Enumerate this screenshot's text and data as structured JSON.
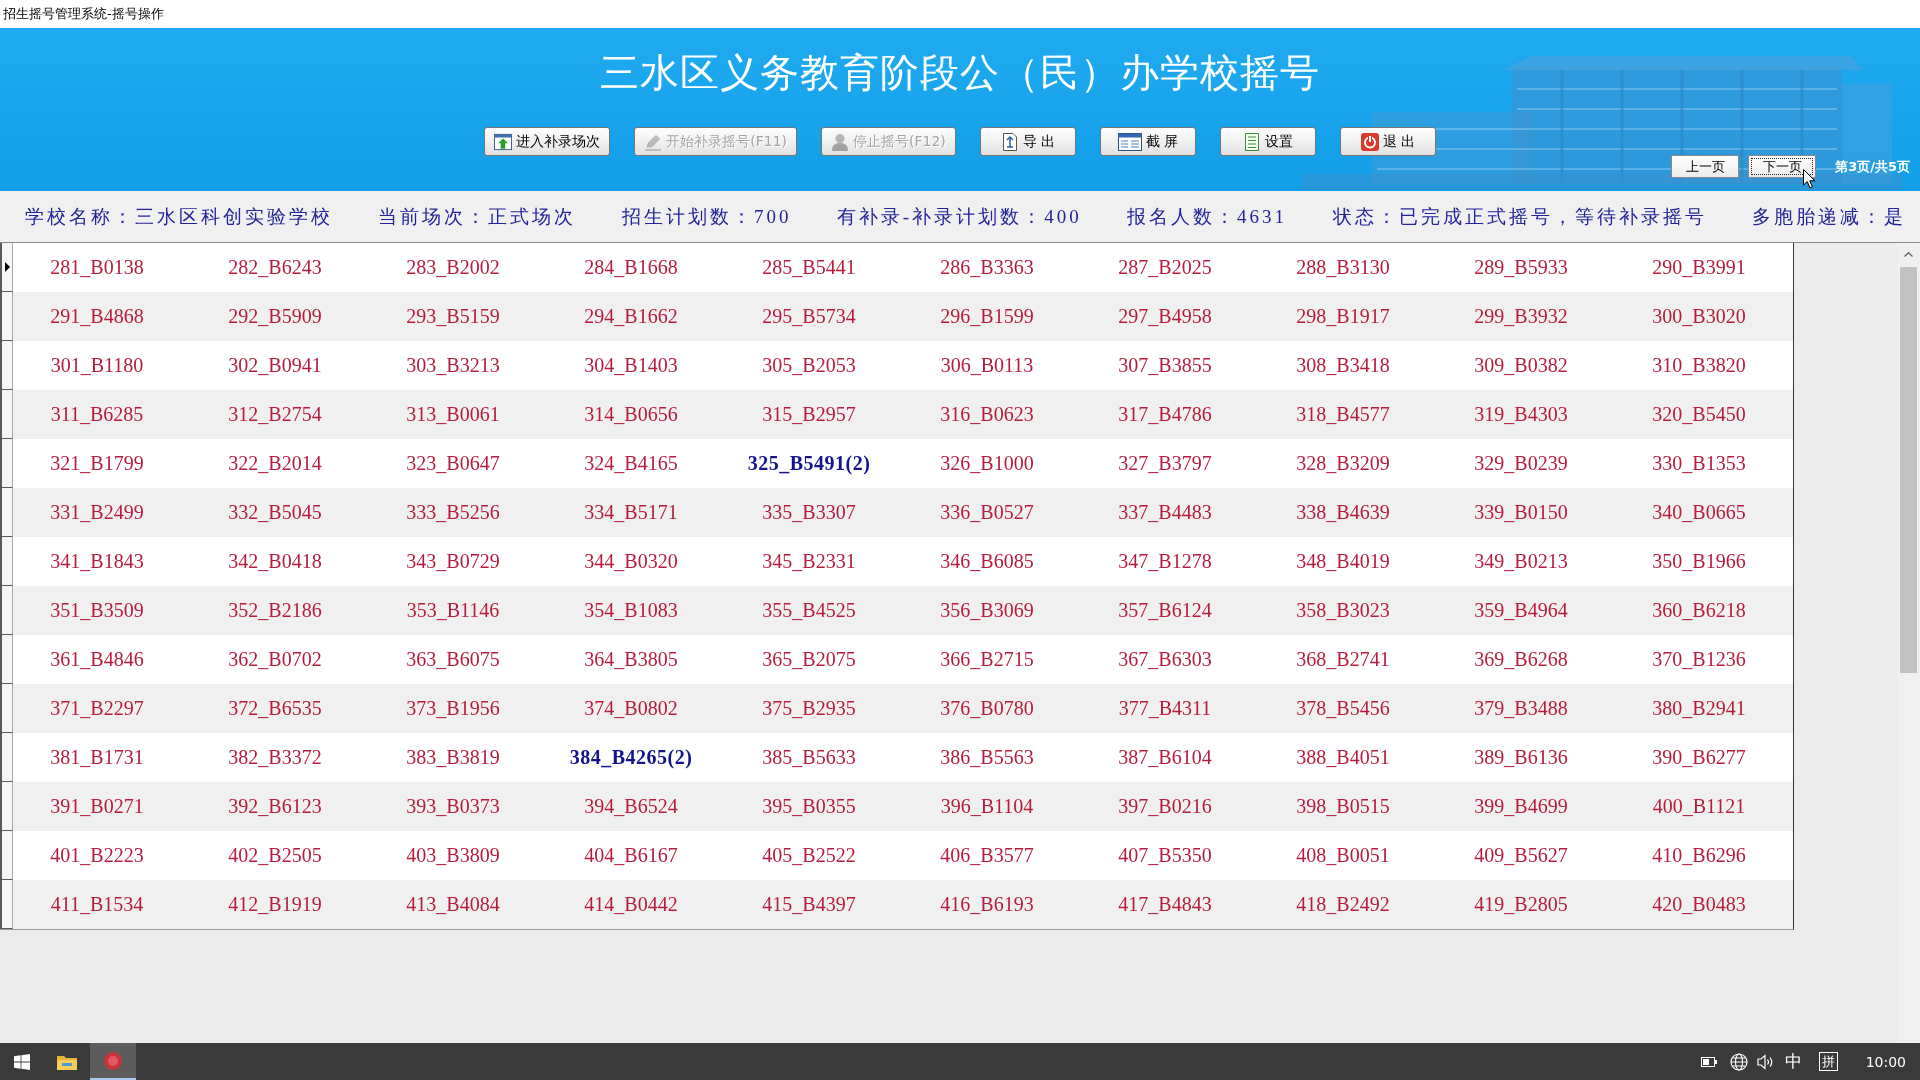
{
  "window": {
    "title": "招生摇号管理系统-摇号操作"
  },
  "header": {
    "title": "三水区义务教育阶段公（民）办学校摇号"
  },
  "toolbar": {
    "buttons": [
      {
        "label": "进入补录场次",
        "disabled": false
      },
      {
        "label": "开始补录摇号(F11)",
        "disabled": true
      },
      {
        "label": "停止摇号(F12)",
        "disabled": true
      },
      {
        "label": "导 出",
        "disabled": false
      },
      {
        "label": "截 屏",
        "disabled": false
      },
      {
        "label": "设置",
        "disabled": false
      },
      {
        "label": "退 出",
        "disabled": false
      }
    ]
  },
  "pager": {
    "buttons": [
      {
        "label": "上一页",
        "focused": false
      },
      {
        "label": "下一页",
        "focused": true
      }
    ],
    "page_info": "第3页/共5页"
  },
  "info_bar": {
    "items": [
      "学校名称：三水区科创实验学校",
      "当前场次：正式场次",
      "招生计划数：700",
      "有补录-补录计划数：400",
      "报名人数：4631",
      "状态：已完成正式摇号，等待补录摇号",
      "多胞胎递减：是"
    ]
  },
  "grid": {
    "rows": [
      {
        "current": true,
        "cells": [
          {
            "text": "281_B0138",
            "highlighted": false
          },
          {
            "text": "282_B6243",
            "highlighted": false
          },
          {
            "text": "283_B2002",
            "highlighted": false
          },
          {
            "text": "284_B1668",
            "highlighted": false
          },
          {
            "text": "285_B5441",
            "highlighted": false
          },
          {
            "text": "286_B3363",
            "highlighted": false
          },
          {
            "text": "287_B2025",
            "highlighted": false
          },
          {
            "text": "288_B3130",
            "highlighted": false
          },
          {
            "text": "289_B5933",
            "highlighted": false
          },
          {
            "text": "290_B3991",
            "highlighted": false
          }
        ]
      },
      {
        "current": false,
        "cells": [
          {
            "text": "291_B4868",
            "highlighted": false
          },
          {
            "text": "292_B5909",
            "highlighted": false
          },
          {
            "text": "293_B5159",
            "highlighted": false
          },
          {
            "text": "294_B1662",
            "highlighted": false
          },
          {
            "text": "295_B5734",
            "highlighted": false
          },
          {
            "text": "296_B1599",
            "highlighted": false
          },
          {
            "text": "297_B4958",
            "highlighted": false
          },
          {
            "text": "298_B1917",
            "highlighted": false
          },
          {
            "text": "299_B3932",
            "highlighted": false
          },
          {
            "text": "300_B3020",
            "highlighted": false
          }
        ]
      },
      {
        "current": false,
        "cells": [
          {
            "text": "301_B1180",
            "highlighted": false
          },
          {
            "text": "302_B0941",
            "highlighted": false
          },
          {
            "text": "303_B3213",
            "highlighted": false
          },
          {
            "text": "304_B1403",
            "highlighted": false
          },
          {
            "text": "305_B2053",
            "highlighted": false
          },
          {
            "text": "306_B0113",
            "highlighted": false
          },
          {
            "text": "307_B3855",
            "highlighted": false
          },
          {
            "text": "308_B3418",
            "highlighted": false
          },
          {
            "text": "309_B0382",
            "highlighted": false
          },
          {
            "text": "310_B3820",
            "highlighted": false
          }
        ]
      },
      {
        "current": false,
        "cells": [
          {
            "text": "311_B6285",
            "highlighted": false
          },
          {
            "text": "312_B2754",
            "highlighted": false
          },
          {
            "text": "313_B0061",
            "highlighted": false
          },
          {
            "text": "314_B0656",
            "highlighted": false
          },
          {
            "text": "315_B2957",
            "highlighted": false
          },
          {
            "text": "316_B0623",
            "highlighted": false
          },
          {
            "text": "317_B4786",
            "highlighted": false
          },
          {
            "text": "318_B4577",
            "highlighted": false
          },
          {
            "text": "319_B4303",
            "highlighted": false
          },
          {
            "text": "320_B5450",
            "highlighted": false
          }
        ]
      },
      {
        "current": false,
        "cells": [
          {
            "text": "321_B1799",
            "highlighted": false
          },
          {
            "text": "322_B2014",
            "highlighted": false
          },
          {
            "text": "323_B0647",
            "highlighted": false
          },
          {
            "text": "324_B4165",
            "highlighted": false
          },
          {
            "text": "325_B5491(2)",
            "highlighted": true
          },
          {
            "text": "326_B1000",
            "highlighted": false
          },
          {
            "text": "327_B3797",
            "highlighted": false
          },
          {
            "text": "328_B3209",
            "highlighted": false
          },
          {
            "text": "329_B0239",
            "highlighted": false
          },
          {
            "text": "330_B1353",
            "highlighted": false
          }
        ]
      },
      {
        "current": false,
        "cells": [
          {
            "text": "331_B2499",
            "highlighted": false
          },
          {
            "text": "332_B5045",
            "highlighted": false
          },
          {
            "text": "333_B5256",
            "highlighted": false
          },
          {
            "text": "334_B5171",
            "highlighted": false
          },
          {
            "text": "335_B3307",
            "highlighted": false
          },
          {
            "text": "336_B0527",
            "highlighted": false
          },
          {
            "text": "337_B4483",
            "highlighted": false
          },
          {
            "text": "338_B4639",
            "highlighted": false
          },
          {
            "text": "339_B0150",
            "highlighted": false
          },
          {
            "text": "340_B0665",
            "highlighted": false
          }
        ]
      },
      {
        "current": false,
        "cells": [
          {
            "text": "341_B1843",
            "highlighted": false
          },
          {
            "text": "342_B0418",
            "highlighted": false
          },
          {
            "text": "343_B0729",
            "highlighted": false
          },
          {
            "text": "344_B0320",
            "highlighted": false
          },
          {
            "text": "345_B2331",
            "highlighted": false
          },
          {
            "text": "346_B6085",
            "highlighted": false
          },
          {
            "text": "347_B1278",
            "highlighted": false
          },
          {
            "text": "348_B4019",
            "highlighted": false
          },
          {
            "text": "349_B0213",
            "highlighted": false
          },
          {
            "text": "350_B1966",
            "highlighted": false
          }
        ]
      },
      {
        "current": false,
        "cells": [
          {
            "text": "351_B3509",
            "highlighted": false
          },
          {
            "text": "352_B2186",
            "highlighted": false
          },
          {
            "text": "353_B1146",
            "highlighted": false
          },
          {
            "text": "354_B1083",
            "highlighted": false
          },
          {
            "text": "355_B4525",
            "highlighted": false
          },
          {
            "text": "356_B3069",
            "highlighted": false
          },
          {
            "text": "357_B6124",
            "highlighted": false
          },
          {
            "text": "358_B3023",
            "highlighted": false
          },
          {
            "text": "359_B4964",
            "highlighted": false
          },
          {
            "text": "360_B6218",
            "highlighted": false
          }
        ]
      },
      {
        "current": false,
        "cells": [
          {
            "text": "361_B4846",
            "highlighted": false
          },
          {
            "text": "362_B0702",
            "highlighted": false
          },
          {
            "text": "363_B6075",
            "highlighted": false
          },
          {
            "text": "364_B3805",
            "highlighted": false
          },
          {
            "text": "365_B2075",
            "highlighted": false
          },
          {
            "text": "366_B2715",
            "highlighted": false
          },
          {
            "text": "367_B6303",
            "highlighted": false
          },
          {
            "text": "368_B2741",
            "highlighted": false
          },
          {
            "text": "369_B6268",
            "highlighted": false
          },
          {
            "text": "370_B1236",
            "highlighted": false
          }
        ]
      },
      {
        "current": false,
        "cells": [
          {
            "text": "371_B2297",
            "highlighted": false
          },
          {
            "text": "372_B6535",
            "highlighted": false
          },
          {
            "text": "373_B1956",
            "highlighted": false
          },
          {
            "text": "374_B0802",
            "highlighted": false
          },
          {
            "text": "375_B2935",
            "highlighted": false
          },
          {
            "text": "376_B0780",
            "highlighted": false
          },
          {
            "text": "377_B4311",
            "highlighted": false
          },
          {
            "text": "378_B5456",
            "highlighted": false
          },
          {
            "text": "379_B3488",
            "highlighted": false
          },
          {
            "text": "380_B2941",
            "highlighted": false
          }
        ]
      },
      {
        "current": false,
        "cells": [
          {
            "text": "381_B1731",
            "highlighted": false
          },
          {
            "text": "382_B3372",
            "highlighted": false
          },
          {
            "text": "383_B3819",
            "highlighted": false
          },
          {
            "text": "384_B4265(2)",
            "highlighted": true
          },
          {
            "text": "385_B5633",
            "highlighted": false
          },
          {
            "text": "386_B5563",
            "highlighted": false
          },
          {
            "text": "387_B6104",
            "highlighted": false
          },
          {
            "text": "388_B4051",
            "highlighted": false
          },
          {
            "text": "389_B6136",
            "highlighted": false
          },
          {
            "text": "390_B6277",
            "highlighted": false
          }
        ]
      },
      {
        "current": false,
        "cells": [
          {
            "text": "391_B0271",
            "highlighted": false
          },
          {
            "text": "392_B6123",
            "highlighted": false
          },
          {
            "text": "393_B0373",
            "highlighted": false
          },
          {
            "text": "394_B6524",
            "highlighted": false
          },
          {
            "text": "395_B0355",
            "highlighted": false
          },
          {
            "text": "396_B1104",
            "highlighted": false
          },
          {
            "text": "397_B0216",
            "highlighted": false
          },
          {
            "text": "398_B0515",
            "highlighted": false
          },
          {
            "text": "399_B4699",
            "highlighted": false
          },
          {
            "text": "400_B1121",
            "highlighted": false
          }
        ]
      },
      {
        "current": false,
        "cells": [
          {
            "text": "401_B2223",
            "highlighted": false
          },
          {
            "text": "402_B2505",
            "highlighted": false
          },
          {
            "text": "403_B3809",
            "highlighted": false
          },
          {
            "text": "404_B6167",
            "highlighted": false
          },
          {
            "text": "405_B2522",
            "highlighted": false
          },
          {
            "text": "406_B3577",
            "highlighted": false
          },
          {
            "text": "407_B5350",
            "highlighted": false
          },
          {
            "text": "408_B0051",
            "highlighted": false
          },
          {
            "text": "409_B5627",
            "highlighted": false
          },
          {
            "text": "410_B6296",
            "highlighted": false
          }
        ]
      },
      {
        "current": false,
        "cells": [
          {
            "text": "411_B1534",
            "highlighted": false
          },
          {
            "text": "412_B1919",
            "highlighted": false
          },
          {
            "text": "413_B4084",
            "highlighted": false
          },
          {
            "text": "414_B0442",
            "highlighted": false
          },
          {
            "text": "415_B4397",
            "highlighted": false
          },
          {
            "text": "416_B6193",
            "highlighted": false
          },
          {
            "text": "417_B4843",
            "highlighted": false
          },
          {
            "text": "418_B2492",
            "highlighted": false
          },
          {
            "text": "419_B2805",
            "highlighted": false
          },
          {
            "text": "420_B0483",
            "highlighted": false
          }
        ]
      }
    ]
  },
  "taskbar": {
    "apps": [
      {
        "active": false
      },
      {
        "active": true
      }
    ],
    "ime_mode": "中",
    "ime_icon": "拼",
    "clock": "10:00"
  }
}
